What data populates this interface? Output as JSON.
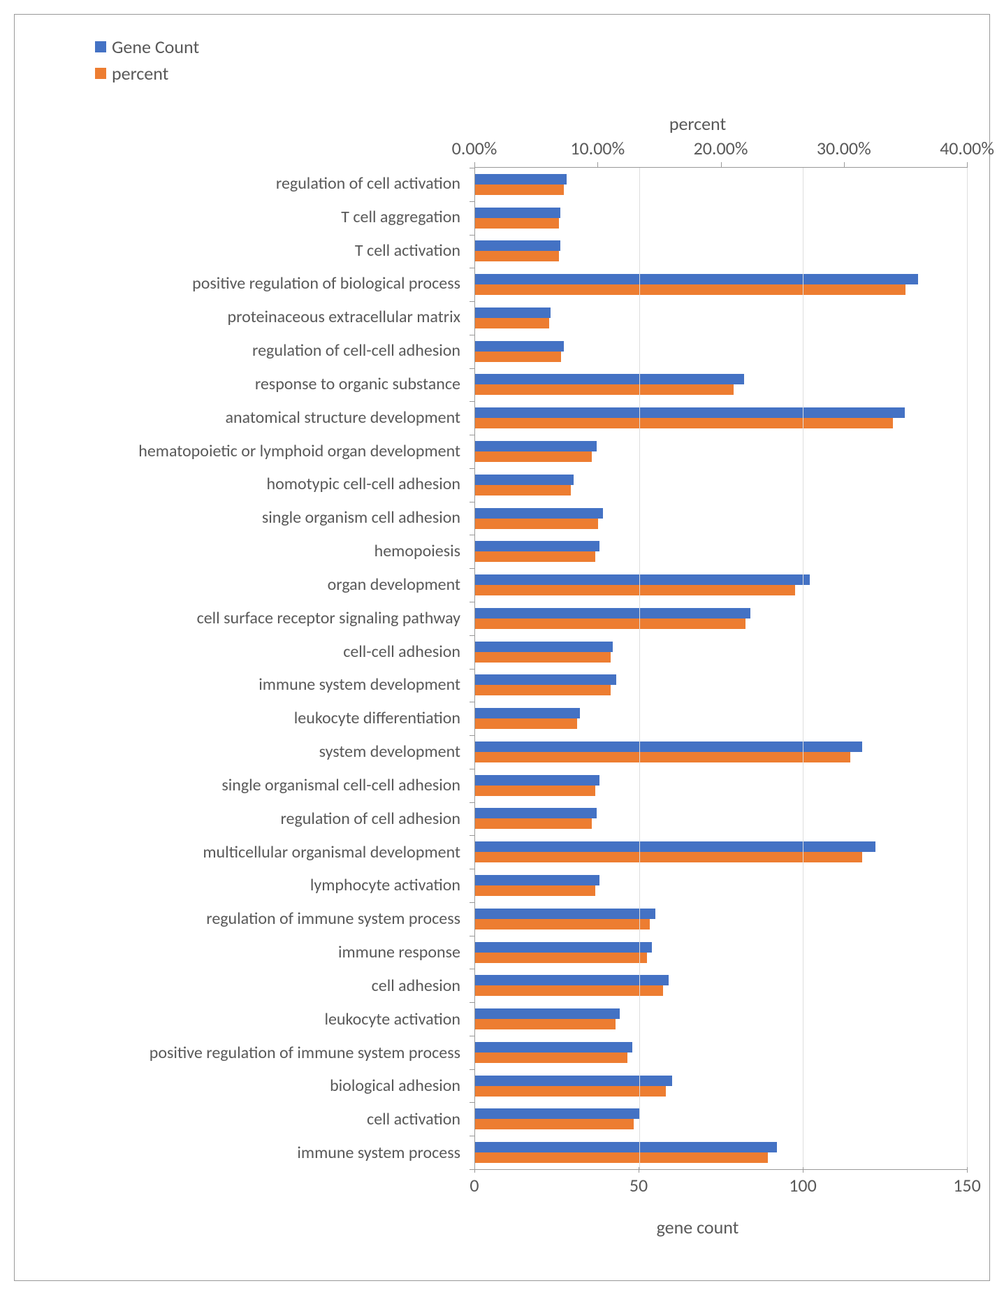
{
  "chart_data": {
    "type": "bar",
    "orientation": "horizontal",
    "categories": [
      "regulation of cell activation",
      "T cell aggregation",
      "T cell activation",
      "positive regulation of biological process",
      "proteinaceous extracellular matrix",
      "regulation of cell-cell adhesion",
      "response to organic substance",
      "anatomical structure development",
      "hematopoietic or lymphoid organ development",
      "homotypic cell-cell adhesion",
      "single organism cell adhesion",
      "hemopoiesis",
      "organ development",
      "cell surface receptor signaling pathway",
      "cell-cell adhesion",
      "immune system development",
      "leukocyte differentiation",
      "system development",
      "single organismal cell-cell adhesion",
      "regulation of cell adhesion",
      "multicellular organismal development",
      "lymphocyte activation",
      "regulation of immune system process",
      "immune response",
      "cell adhesion",
      "leukocyte activation",
      "positive regulation of immune system process",
      "biological adhesion",
      "cell activation",
      "immune system process"
    ],
    "series": [
      {
        "name": "Gene Count",
        "axis": "bottom",
        "values": [
          28,
          26,
          26,
          135,
          23,
          27,
          82,
          131,
          37,
          30,
          39,
          38,
          102,
          84,
          42,
          43,
          32,
          118,
          38,
          37,
          122,
          38,
          55,
          54,
          59,
          44,
          48,
          60,
          50,
          92
        ]
      },
      {
        "name": "percent",
        "axis": "top",
        "values": [
          7.2,
          6.8,
          6.8,
          35.0,
          6.0,
          7.0,
          21.0,
          34.0,
          9.5,
          7.8,
          10.0,
          9.8,
          26.0,
          22.0,
          11.0,
          11.0,
          8.3,
          30.5,
          9.8,
          9.5,
          31.5,
          9.8,
          14.2,
          14.0,
          15.3,
          11.4,
          12.4,
          15.5,
          12.9,
          23.8
        ]
      }
    ],
    "top_axis": {
      "label": "percent",
      "ticks": [
        "0.00%",
        "10.00%",
        "20.00%",
        "30.00%",
        "40.00%"
      ],
      "max": 40
    },
    "bottom_axis": {
      "label": "gene count",
      "ticks": [
        "0",
        "50",
        "100",
        "150"
      ],
      "max": 150
    },
    "colors": {
      "gene_count": "#4472C4",
      "percent": "#ED7D31"
    }
  }
}
